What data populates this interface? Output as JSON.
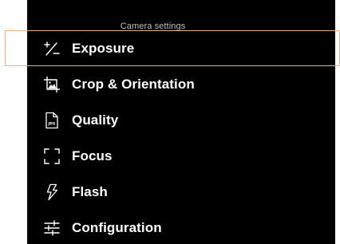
{
  "header": {
    "title": "Camera settings"
  },
  "menu": {
    "items": [
      {
        "id": "exposure",
        "label": "Exposure",
        "icon": "exposure-plus-minus-icon",
        "selected": true
      },
      {
        "id": "crop",
        "label": "Crop & Orientation",
        "icon": "crop-image-icon",
        "selected": false
      },
      {
        "id": "quality",
        "label": "Quality",
        "icon": "jpg-file-icon",
        "selected": false
      },
      {
        "id": "focus",
        "label": "Focus",
        "icon": "focus-brackets-icon",
        "selected": false
      },
      {
        "id": "flash",
        "label": "Flash",
        "icon": "flash-bolt-icon",
        "selected": false
      },
      {
        "id": "configuration",
        "label": "Configuration",
        "icon": "sliders-icon",
        "selected": false
      }
    ]
  },
  "colors": {
    "background": "#000000",
    "text": "#ffffff",
    "title_text": "#bdbdbd",
    "highlight_border": "#f6ae7b"
  }
}
